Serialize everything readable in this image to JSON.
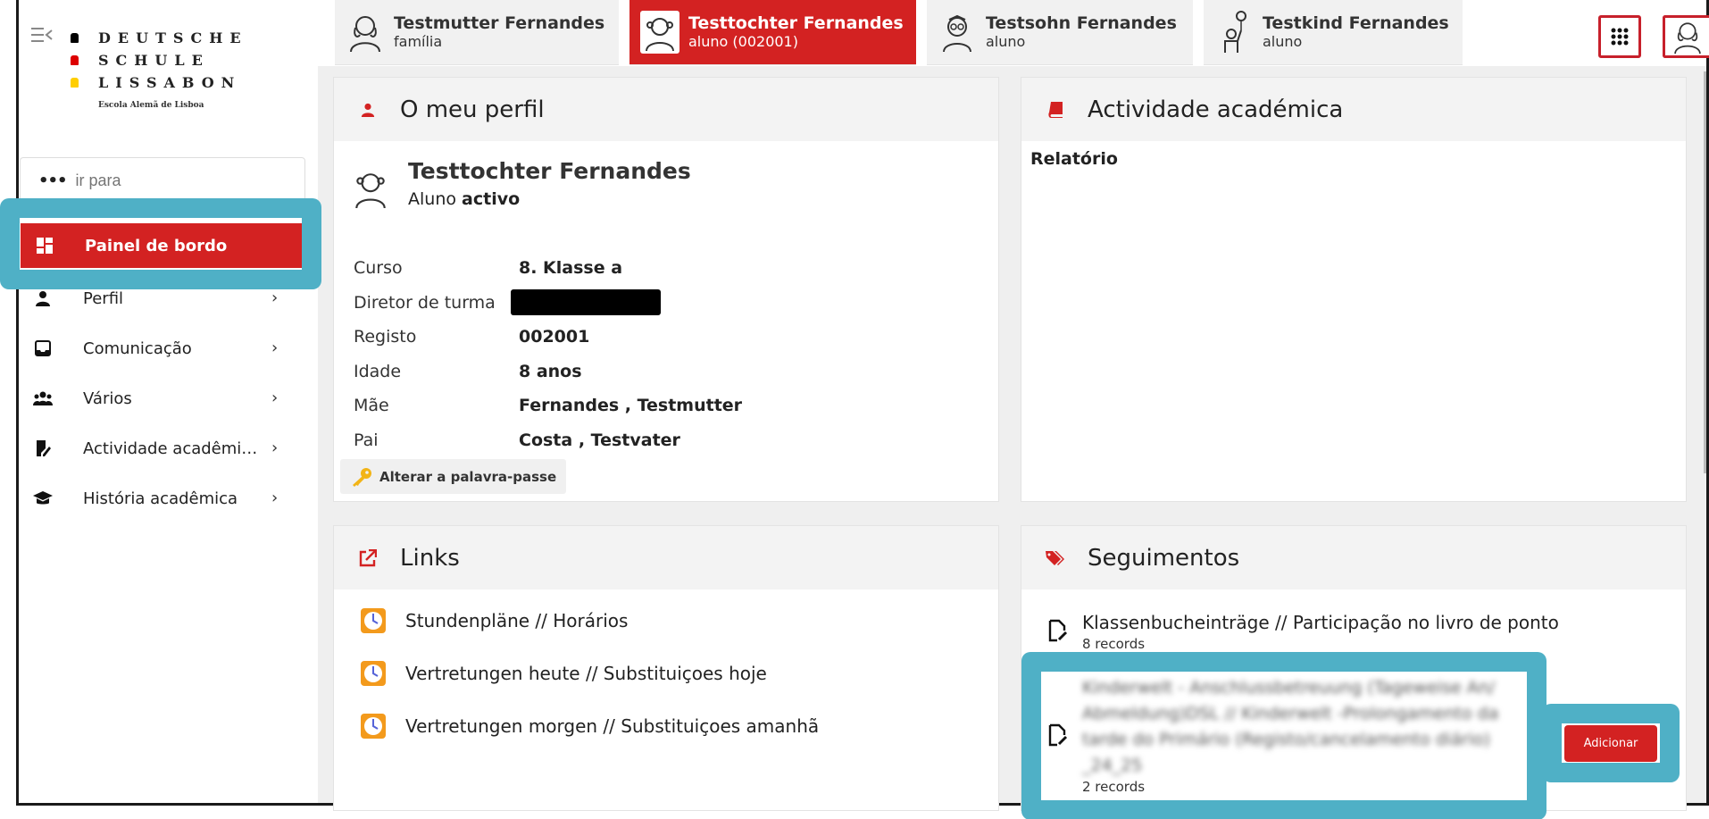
{
  "sidebar": {
    "logo": {
      "line1": "DEUTSCHE",
      "line2": "SCHULE",
      "line3": "LISSABON",
      "subtitle": "Escola Alemã de Lisboa",
      "colors": [
        "#000000",
        "#dd0000",
        "#ffce00"
      ]
    },
    "search": {
      "placeholder": "ir para",
      "icon": "ellipsis-icon"
    },
    "items": [
      {
        "label": "Painel de bordo",
        "icon": "dashboard-icon",
        "active": true
      },
      {
        "label": "Perfil",
        "icon": "person-icon"
      },
      {
        "label": "Comunicação",
        "icon": "inbox-icon"
      },
      {
        "label": "Vários",
        "icon": "group-icon"
      },
      {
        "label": "Actividade acadêmi…",
        "icon": "edit-book-icon"
      },
      {
        "label": "História acadêmica",
        "icon": "graduation-cap-icon"
      }
    ]
  },
  "tabs": [
    {
      "name": "Testmutter Fernandes",
      "role": "família"
    },
    {
      "name": "Testtochter Fernandes",
      "role": "aluno (002001)",
      "active": true
    },
    {
      "name": "Testsohn Fernandes",
      "role": "aluno"
    },
    {
      "name": "Testkind Fernandes",
      "role": "aluno"
    }
  ],
  "profile": {
    "title": "O meu perfil",
    "name": "Testtochter Fernandes",
    "status_prefix": "Aluno",
    "status": "activo",
    "fields": [
      {
        "label": "Curso",
        "value": "8. Klasse a"
      },
      {
        "label": "Diretor de turma",
        "value": ""
      },
      {
        "label": "Registo",
        "value": "002001"
      },
      {
        "label": "Idade",
        "value": "8 anos"
      },
      {
        "label": "Mãe",
        "value": "Fernandes , Testmutter"
      },
      {
        "label": "Pai",
        "value": "Costa , Testvater"
      }
    ],
    "password_button": "Alterar a palavra-passe"
  },
  "academic": {
    "title": "Actividade académica",
    "report_label": "Relatório"
  },
  "links": {
    "title": "Links",
    "items": [
      "Stundenpläne // Horários",
      "Vertretungen heute // Substituiçoes hoje",
      "Vertretungen morgen // Substituiçoes amanhã"
    ]
  },
  "followups": {
    "title": "Seguimentos",
    "items": [
      {
        "title": "Klassenbucheinträge // Participação no livro de ponto",
        "count": "8 records"
      },
      {
        "title": "Kinderwelt - Anschlussbetreuung (Tageweise An/ Abmeldung)DSL // Kinderwelt -Prolongamento da tarde do Primário (Registo/cancelamento diário) _24_25",
        "count": "2 records"
      }
    ],
    "add_button": "Adicionar"
  },
  "colors": {
    "accent": "#d32222",
    "highlight": "#4fb0c6"
  }
}
